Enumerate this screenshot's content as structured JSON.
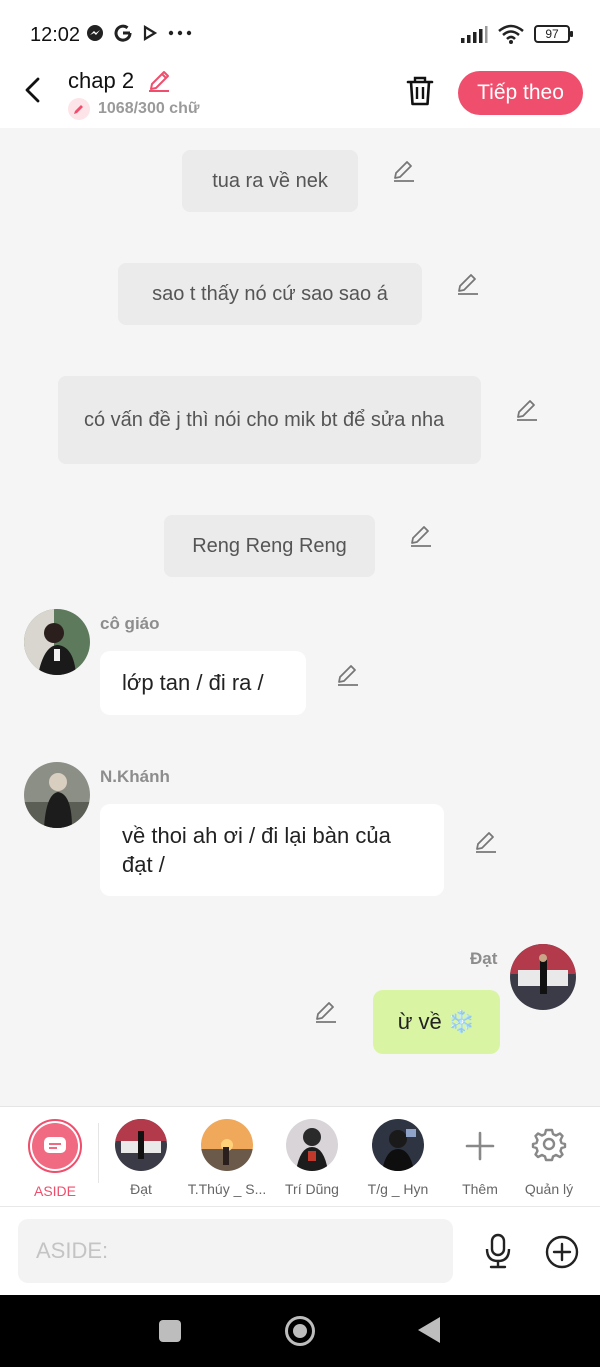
{
  "status_bar": {
    "time": "12:02",
    "left_icons": [
      "messenger-icon",
      "google-icon",
      "play-icon",
      "more-dots-icon"
    ],
    "right_icons": [
      "signal-icon",
      "wifi-icon",
      "battery-icon"
    ],
    "battery": "97"
  },
  "header": {
    "title": "chap 2",
    "word_count": "1068/300 chữ",
    "next_label": "Tiếp theo",
    "accent_color": "#ef4e6c"
  },
  "messages": [
    {
      "type": "narration",
      "text": "tua ra về nek"
    },
    {
      "type": "narration",
      "text": "sao t thấy nó cứ sao sao á"
    },
    {
      "type": "narration",
      "text": "có vấn đề j thì nói cho mik bt để sửa nha"
    },
    {
      "type": "narration",
      "text": "Reng Reng Reng"
    },
    {
      "type": "left",
      "sender": "cô giáo",
      "text": "lớp tan / đi ra /"
    },
    {
      "type": "left",
      "sender": "N.Khánh",
      "text": "về thoi ah ơi / đi lại bàn của đạt /"
    },
    {
      "type": "right",
      "sender": "Đạt",
      "text": "ừ về ❄️"
    }
  ],
  "characters": [
    {
      "label": "ASIDE",
      "active": true
    },
    {
      "label": "Đạt"
    },
    {
      "label": "T.Thúy _ S..."
    },
    {
      "label": "Trí Dũng"
    },
    {
      "label": "T/g _ Hyn"
    },
    {
      "label": "Thêm"
    },
    {
      "label": "Quản lý"
    }
  ],
  "input": {
    "placeholder": "ASIDE:"
  }
}
